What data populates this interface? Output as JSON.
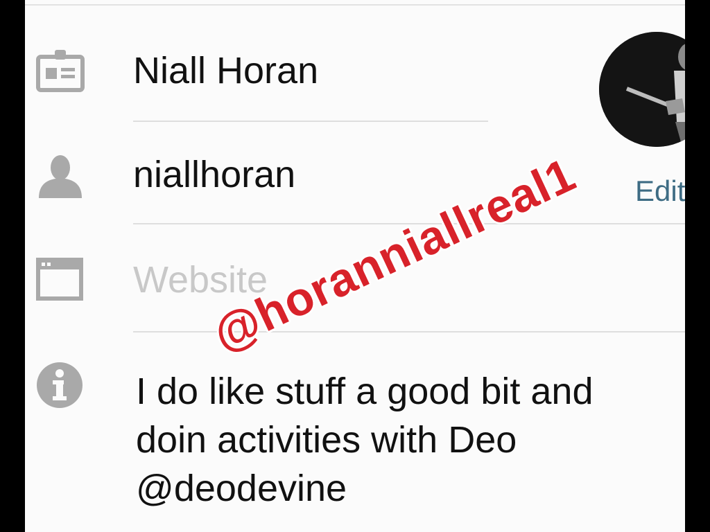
{
  "profile": {
    "name": "Niall Horan",
    "username": "niallhoran",
    "website_placeholder": "Website",
    "bio": "I do like stuff a good bit and\ndoin activities with Deo\n@deodevine",
    "edit_label": "Edit"
  },
  "icons": {
    "name": "id-card-icon",
    "username": "person-icon",
    "website": "browser-window-icon",
    "bio": "info-icon"
  },
  "watermark": "@horanniallreal1",
  "colors": {
    "icon_gray": "#a9a9a9",
    "edit_link": "#3e6c84",
    "watermark": "#d8222a"
  }
}
